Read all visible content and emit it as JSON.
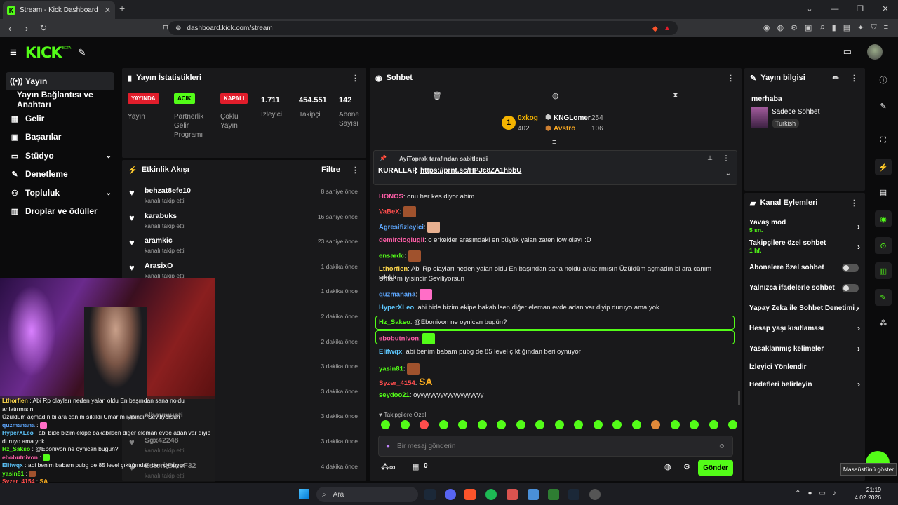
{
  "browser": {
    "tab_title": "Stream - Kick Dashboard",
    "url": "dashboard.kick.com/stream"
  },
  "header": {
    "logo": "KICK",
    "beta": "BETA"
  },
  "sidebar": {
    "items": [
      {
        "label": "Yayın",
        "icon": "broadcast-icon"
      },
      {
        "label": "Yayın Bağlantısı ve Anahtarı",
        "icon": ""
      },
      {
        "label": "Gelir",
        "icon": "revenue-icon"
      },
      {
        "label": "Başarılar",
        "icon": "achievements-icon"
      },
      {
        "label": "Stüdyo",
        "icon": "studio-icon"
      },
      {
        "label": "Denetleme",
        "icon": "moderation-icon"
      },
      {
        "label": "Topluluk",
        "icon": "community-icon"
      },
      {
        "label": "Droplar ve ödüller",
        "icon": "drops-icon"
      }
    ]
  },
  "stats": {
    "title": "Yayın İstatistikleri",
    "cols": [
      {
        "badge": "YAYINDA",
        "label": "Yayın"
      },
      {
        "badge": "ACIK",
        "label": "Partnerlik Gelir Programı"
      },
      {
        "badge": "KAPALI",
        "label": "Çoklu Yayın"
      },
      {
        "value": "1.711",
        "label": "İzleyici"
      },
      {
        "value": "454.551",
        "label": "Takipçi"
      },
      {
        "value": "142",
        "label": "Abone Sayısı"
      }
    ]
  },
  "activity": {
    "title": "Etkinlik Akışı",
    "filter": "Filtre",
    "items": [
      {
        "name": "behzat8efe10",
        "action": "kanalı takip etti",
        "time": "8 saniye önce"
      },
      {
        "name": "karabuks",
        "action": "kanalı takip etti",
        "time": "16 saniye önce"
      },
      {
        "name": "aramkic",
        "action": "kanalı takip etti",
        "time": "23 saniye önce"
      },
      {
        "name": "ArasixO",
        "action": "kanalı takip etti",
        "time": "1 dakika önce"
      },
      {
        "name": "",
        "action": "",
        "time": "1 dakika önce"
      },
      {
        "name": "",
        "action": "",
        "time": "2 dakika önce"
      },
      {
        "name": "",
        "action": "",
        "time": "2 dakika önce"
      },
      {
        "name": "",
        "action": "",
        "time": "3 dakika önce"
      },
      {
        "name": "",
        "action": "",
        "time": "3 dakika önce"
      },
      {
        "name": "albaymusti",
        "action": "",
        "time": "3 dakika önce"
      },
      {
        "name": "Sgx42248",
        "action": "kanalı takip etti",
        "time": "3 dakika önce"
      },
      {
        "name": "EstoriIBlueF32",
        "action": "kanalı takip etti",
        "time": "4 dakika önce"
      }
    ]
  },
  "overlay_chat": [
    {
      "user": "Lthorfien",
      "text": "Abi Rp olayları neden yalan oldu En başından sana noldu anlatırmısın"
    },
    {
      "user": "",
      "text": "Üzüldüm açmadın bi ara canım sıkıldı Umarım iyisindir Seviliyorsun"
    },
    {
      "user": "quzmanana",
      "text": ""
    },
    {
      "user": "HyperXLeo",
      "text": "abi bide bizim ekipe bakabilsen diğer eleman evde adan var diyip duruyo ama yok"
    },
    {
      "user": "Hz_Sakso",
      "text": "@Ebonivon ne oynican bugün?"
    },
    {
      "user": "ebobutnivon",
      "text": ""
    },
    {
      "user": "Elifwqx",
      "text": "abi benim babam pubg de 85 level çıktığından beri oynuyor"
    },
    {
      "user": "yasin81",
      "text": ""
    },
    {
      "user": "Syzer_4154",
      "text": "SA"
    }
  ],
  "chat": {
    "title": "Sohbet",
    "leaderboard": [
      {
        "rank": "1",
        "name": "0xkog",
        "value": "402"
      },
      {
        "name": "KNGLomer",
        "value": "254"
      },
      {
        "name": "Avstro",
        "value": "106"
      }
    ],
    "pinned_by": "AyiToprak tarafından sabitlendi",
    "pinned_text": "KURALLAR",
    "pinned_link": "https://prnt.sc/HPJc8ZA1hbbU",
    "messages": [
      {
        "user": "HONOS",
        "text": "onu her kes diyor abim",
        "color": "#ff5ea8"
      },
      {
        "user": "VaBeX",
        "text": "",
        "color": "#ff4d4d",
        "emote": true
      },
      {
        "user": "Agresifizleyici",
        "text": "",
        "color": "#5ea8ff",
        "emote": true
      },
      {
        "user": "demircioglugil",
        "text": "o erkekler arasındaki en büyük yalan zaten low olayı :D",
        "color": "#ff5ea8"
      },
      {
        "user": "ensardc",
        "text": "",
        "color": "#53fc18",
        "emote": true
      },
      {
        "user": "Lthorfien",
        "text": "Abi Rp olayları neden yalan oldu En başından sana noldu anlatırmısın Üzüldüm açmadın bi ara canım sıkıldı",
        "color": "#ffd84d"
      },
      {
        "user": "",
        "text": "Umarım iyisindir Seviliyorsun",
        "color": "#ffffff"
      },
      {
        "user": "quzmanana",
        "text": "",
        "color": "#5ea8ff",
        "emote": true
      },
      {
        "user": "HyperXLeo",
        "text": "abi bide bizim ekipe bakabilsen diğer eleman evde adan var diyip duruyo ama yok",
        "color": "#5ec8ff"
      },
      {
        "user": "Hz_Sakso",
        "text": "@Ebonivon ne oynican bugün?",
        "color": "#53fc18"
      },
      {
        "user": "ebobutnivon",
        "text": "",
        "color": "#ff5ea8",
        "emote": true
      },
      {
        "user": "Elifwqx",
        "text": "abi benim babam pubg de 85 level çıktığından beri oynuyor",
        "color": "#5ec8ff"
      },
      {
        "user": "yasin81",
        "text": "",
        "color": "#53fc18",
        "emote": true
      },
      {
        "user": "Syzer_4154",
        "text": "SA",
        "color": "#ff4d4d"
      },
      {
        "user": "seydoo21",
        "text": "oyyyyyyyyyyyyyyyyyyyy",
        "color": "#53fc18"
      }
    ],
    "followers_only": "Takipçilere Özel",
    "input_placeholder": "Bir mesaj gönderin",
    "points": "0",
    "send": "Gönder"
  },
  "info": {
    "title": "Yayın bilgisi",
    "stream_title": "merhaba",
    "category": "Sadece Sohbet",
    "language": "Turkish"
  },
  "actions": {
    "title": "Kanal Eylemleri",
    "items": [
      {
        "label": "Yavaş mod",
        "sub": "5 sn.",
        "kind": "chevron"
      },
      {
        "label": "Takipçilere özel sohbet",
        "sub": "1 hf.",
        "kind": "chevron"
      },
      {
        "label": "Abonelere özel sohbet",
        "sub": "",
        "kind": "toggle"
      },
      {
        "label": "Yalnızca ifadelerle sohbet",
        "sub": "",
        "kind": "toggle"
      },
      {
        "label": "Yapay Zeka ile Sohbet Denetimi",
        "sub": "",
        "kind": "external"
      },
      {
        "label": "Hesap yaşı kısıtlaması",
        "sub": "",
        "kind": "chevron"
      },
      {
        "label": "Yasaklanmış kelimeler",
        "sub": "",
        "kind": "chevron"
      },
      {
        "label": "İzleyici Yönlendir",
        "sub": "",
        "kind": "none"
      },
      {
        "label": "Hedefleri belirleyin",
        "sub": "",
        "kind": "chevron"
      }
    ]
  },
  "tooltip": "Masaüstünü göster",
  "taskbar": {
    "search": "Ara",
    "time": "21:19",
    "date": "4.02.2026"
  },
  "colors": {
    "accent": "#53fc18",
    "danger": "#e11d2b",
    "panel": "#19191b",
    "bg": "#0b0b0c"
  }
}
